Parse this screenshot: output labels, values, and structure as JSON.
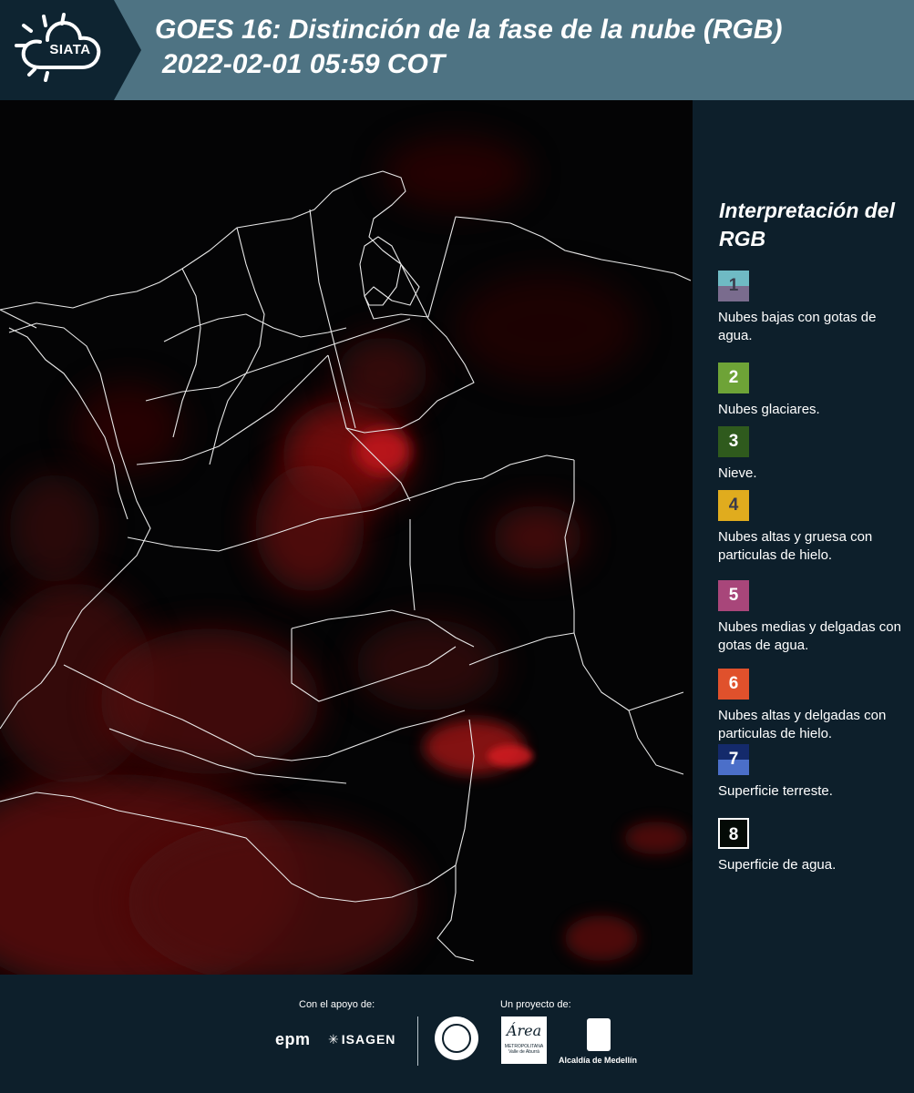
{
  "header": {
    "logo_text": "SIATA",
    "title": "GOES 16: Distinción de la fase de la nube (RGB)",
    "subtitle": "2022-02-01 05:59 COT"
  },
  "legend": {
    "title": "Interpretación del RGB",
    "items": [
      {
        "number": "1",
        "label": "Nubes bajas con gotas de agua.",
        "color_top": "#6fbac4",
        "color_bottom": "#7a6c8e",
        "text_color": "#3a3a4a"
      },
      {
        "number": "2",
        "label": "Nubes glaciares.",
        "color_top": "#6ea337",
        "color_bottom": "#6ea337",
        "text_color": "#ffffff"
      },
      {
        "number": "3",
        "label": "Nieve.",
        "color_top": "#2f5a1d",
        "color_bottom": "#2f5a1d",
        "text_color": "#ffffff"
      },
      {
        "number": "4",
        "label": "Nubes altas y gruesa con particulas de hielo.",
        "color_top": "#e0ac1e",
        "color_bottom": "#e0ac1e",
        "text_color": "#3a3a4a"
      },
      {
        "number": "5",
        "label": "Nubes medias y delgadas con gotas de agua.",
        "color_top": "#a8467a",
        "color_bottom": "#a8467a",
        "text_color": "#ffffff"
      },
      {
        "number": "6",
        "label": "Nubes altas y delgadas con particulas de hielo.",
        "color_top": "#e0512c",
        "color_bottom": "#e0512c",
        "text_color": "#ffffff"
      },
      {
        "number": "7",
        "label": "Superficie terreste.",
        "color_top": "#142a6b",
        "color_bottom": "#4b6fc9",
        "text_color": "#ffffff"
      },
      {
        "number": "8",
        "label": "Superficie de agua.",
        "color_top": "#040a06",
        "color_bottom": "#040a06",
        "text_color": "#ffffff",
        "border": "#ffffff"
      }
    ]
  },
  "footer": {
    "support_label": "Con el apoyo de:",
    "project_label": "Un proyecto de:",
    "partners": [
      "epm",
      "ISAGEN"
    ],
    "area_logo_word": "Área",
    "area_logo_sub": "METROPOLITANA Valle de Aburrá",
    "alcaldia": "Alcaldía de Medellín"
  }
}
